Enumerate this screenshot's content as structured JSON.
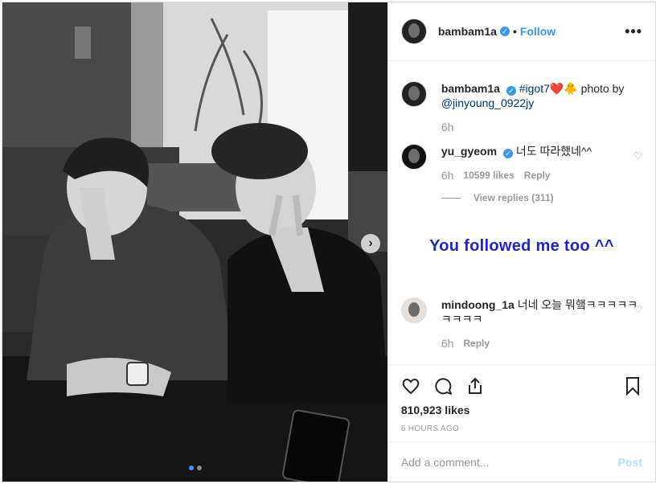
{
  "header": {
    "username": "bambam1a",
    "separator": "•",
    "follow_label": "Follow",
    "more_label": "•••"
  },
  "caption": {
    "username": "bambam1a",
    "hashtag": "#igot7",
    "emoji": "❤️🐥",
    "text": "photo by",
    "mention": "@jinyoung_0922jy",
    "time": "6h"
  },
  "comments": [
    {
      "username": "yu_gyeom",
      "text": "너도 따라했네^^",
      "time": "6h",
      "likes": "10599 likes",
      "reply_label": "Reply",
      "view_replies": "View replies (311)"
    },
    {
      "username": "mindoong_1a",
      "text": "너네 오늘 뭐햌ㅋㅋㅋㅋㅋㅋㅋㅋㅋ",
      "time": "6h",
      "reply_label": "Reply"
    }
  ],
  "overlay": {
    "text": "You followed me too ^^",
    "color": "#2323cc"
  },
  "actions": {
    "likes": "810,923 likes",
    "timestamp": "6 HOURS AGO"
  },
  "add_comment": {
    "placeholder": "Add a comment...",
    "post_label": "Post"
  },
  "photo": {
    "slides": 2,
    "active_slide": 1
  },
  "icons": [
    "verified-icon",
    "more-icon",
    "heart-icon",
    "comment-icon",
    "share-icon",
    "bookmark-icon",
    "chevron-right-icon"
  ]
}
